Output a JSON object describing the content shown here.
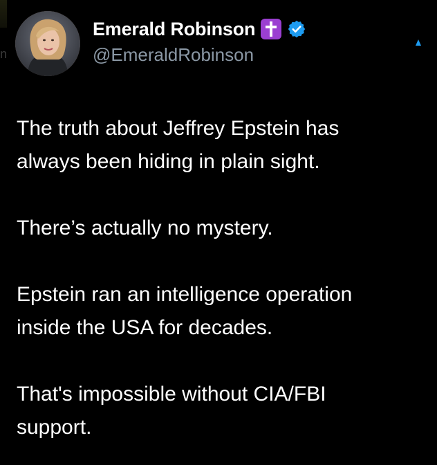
{
  "author": {
    "display_name": "Emerald Robinson",
    "handle": "@EmeraldRobinson",
    "badges": [
      "cross-icon",
      "verified-icon"
    ],
    "accent_colors": {
      "cross_badge": "#9b3fd1",
      "verified": "#1d9bf0",
      "handle": "#8b98a5"
    }
  },
  "tweet": {
    "paragraphs": [
      "The truth about Jeffrey Epstein has\nalways been hiding in plain sight.",
      "There’s actually no mystery.",
      "Epstein ran an intelligence operation\ninside the USA for decades.",
      "That's impossible without CIA/FBI\nsupport."
    ]
  },
  "theme": {
    "background": "#000000",
    "text": "#ffffff"
  }
}
